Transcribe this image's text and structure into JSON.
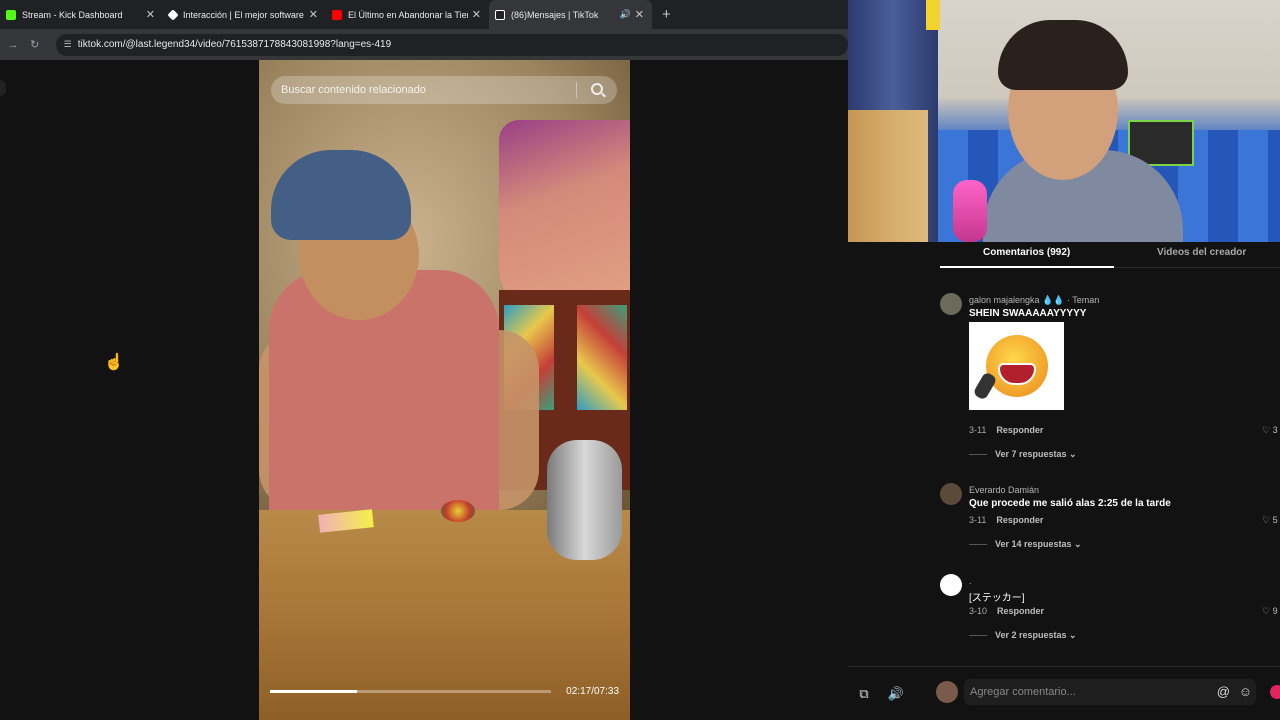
{
  "browser": {
    "tabs": [
      {
        "title": "Stream - Kick Dashboard",
        "favicon_color": "#53fc18",
        "active": false
      },
      {
        "title": "Interacción | El mejor software p",
        "favicon_color": "#ffffff",
        "active": false
      },
      {
        "title": "El Último en Abandonar la Tierra",
        "favicon_color": "#ff0000",
        "active": false
      },
      {
        "title": "(86)Mensajes | TikTok",
        "favicon_color": "#ffffff",
        "active": true
      }
    ],
    "close_glyph": "✕",
    "new_tab_glyph": "+",
    "speaker_glyph": "🔊",
    "url": "tiktok.com/@last.legend34/video/7615387178843081998?lang=es-419"
  },
  "video": {
    "search_placeholder": "Buscar contenido relacionado",
    "progress_fraction": 0.31,
    "timecode": "02:17/07:33"
  },
  "comments_panel": {
    "tabs": [
      "Comentarios (992)",
      "Videos del creador"
    ],
    "comments": [
      {
        "user": "galon majalengka 💧💧 · Teman",
        "text": "SHEIN SWAAAAAYYYYY",
        "date": "3-11",
        "reply": "Responder",
        "likes": "♡ 3",
        "replies": "Ver 7 respuestas ⌄",
        "has_sticker": true,
        "avatar_color": "#6b6b5a"
      },
      {
        "user": "Everardo Damián",
        "text": "Que procede me salió alas 2:25 de la tarde",
        "date": "3-11",
        "reply": "Responder",
        "likes": "♡ 5",
        "replies": "Ver 14 respuestas ⌄",
        "has_sticker": false,
        "avatar_color": "#5b4a3a"
      },
      {
        "user": ".",
        "text": "[ステッカー]",
        "date": "3-10",
        "reply": "Responder",
        "likes": "♡ 9",
        "replies": "Ver 2 respuestas ⌄",
        "has_sticker": false,
        "avatar_color": "#ffffff"
      }
    ],
    "comment_input_placeholder": "Agregar comentario...",
    "mention_glyph": "@",
    "emoji_glyph": "☺"
  },
  "controls": {
    "up_glyph": "︿",
    "down_glyph": "﹀",
    "share_glyph": "⧉",
    "volume_glyph": "🔊"
  }
}
